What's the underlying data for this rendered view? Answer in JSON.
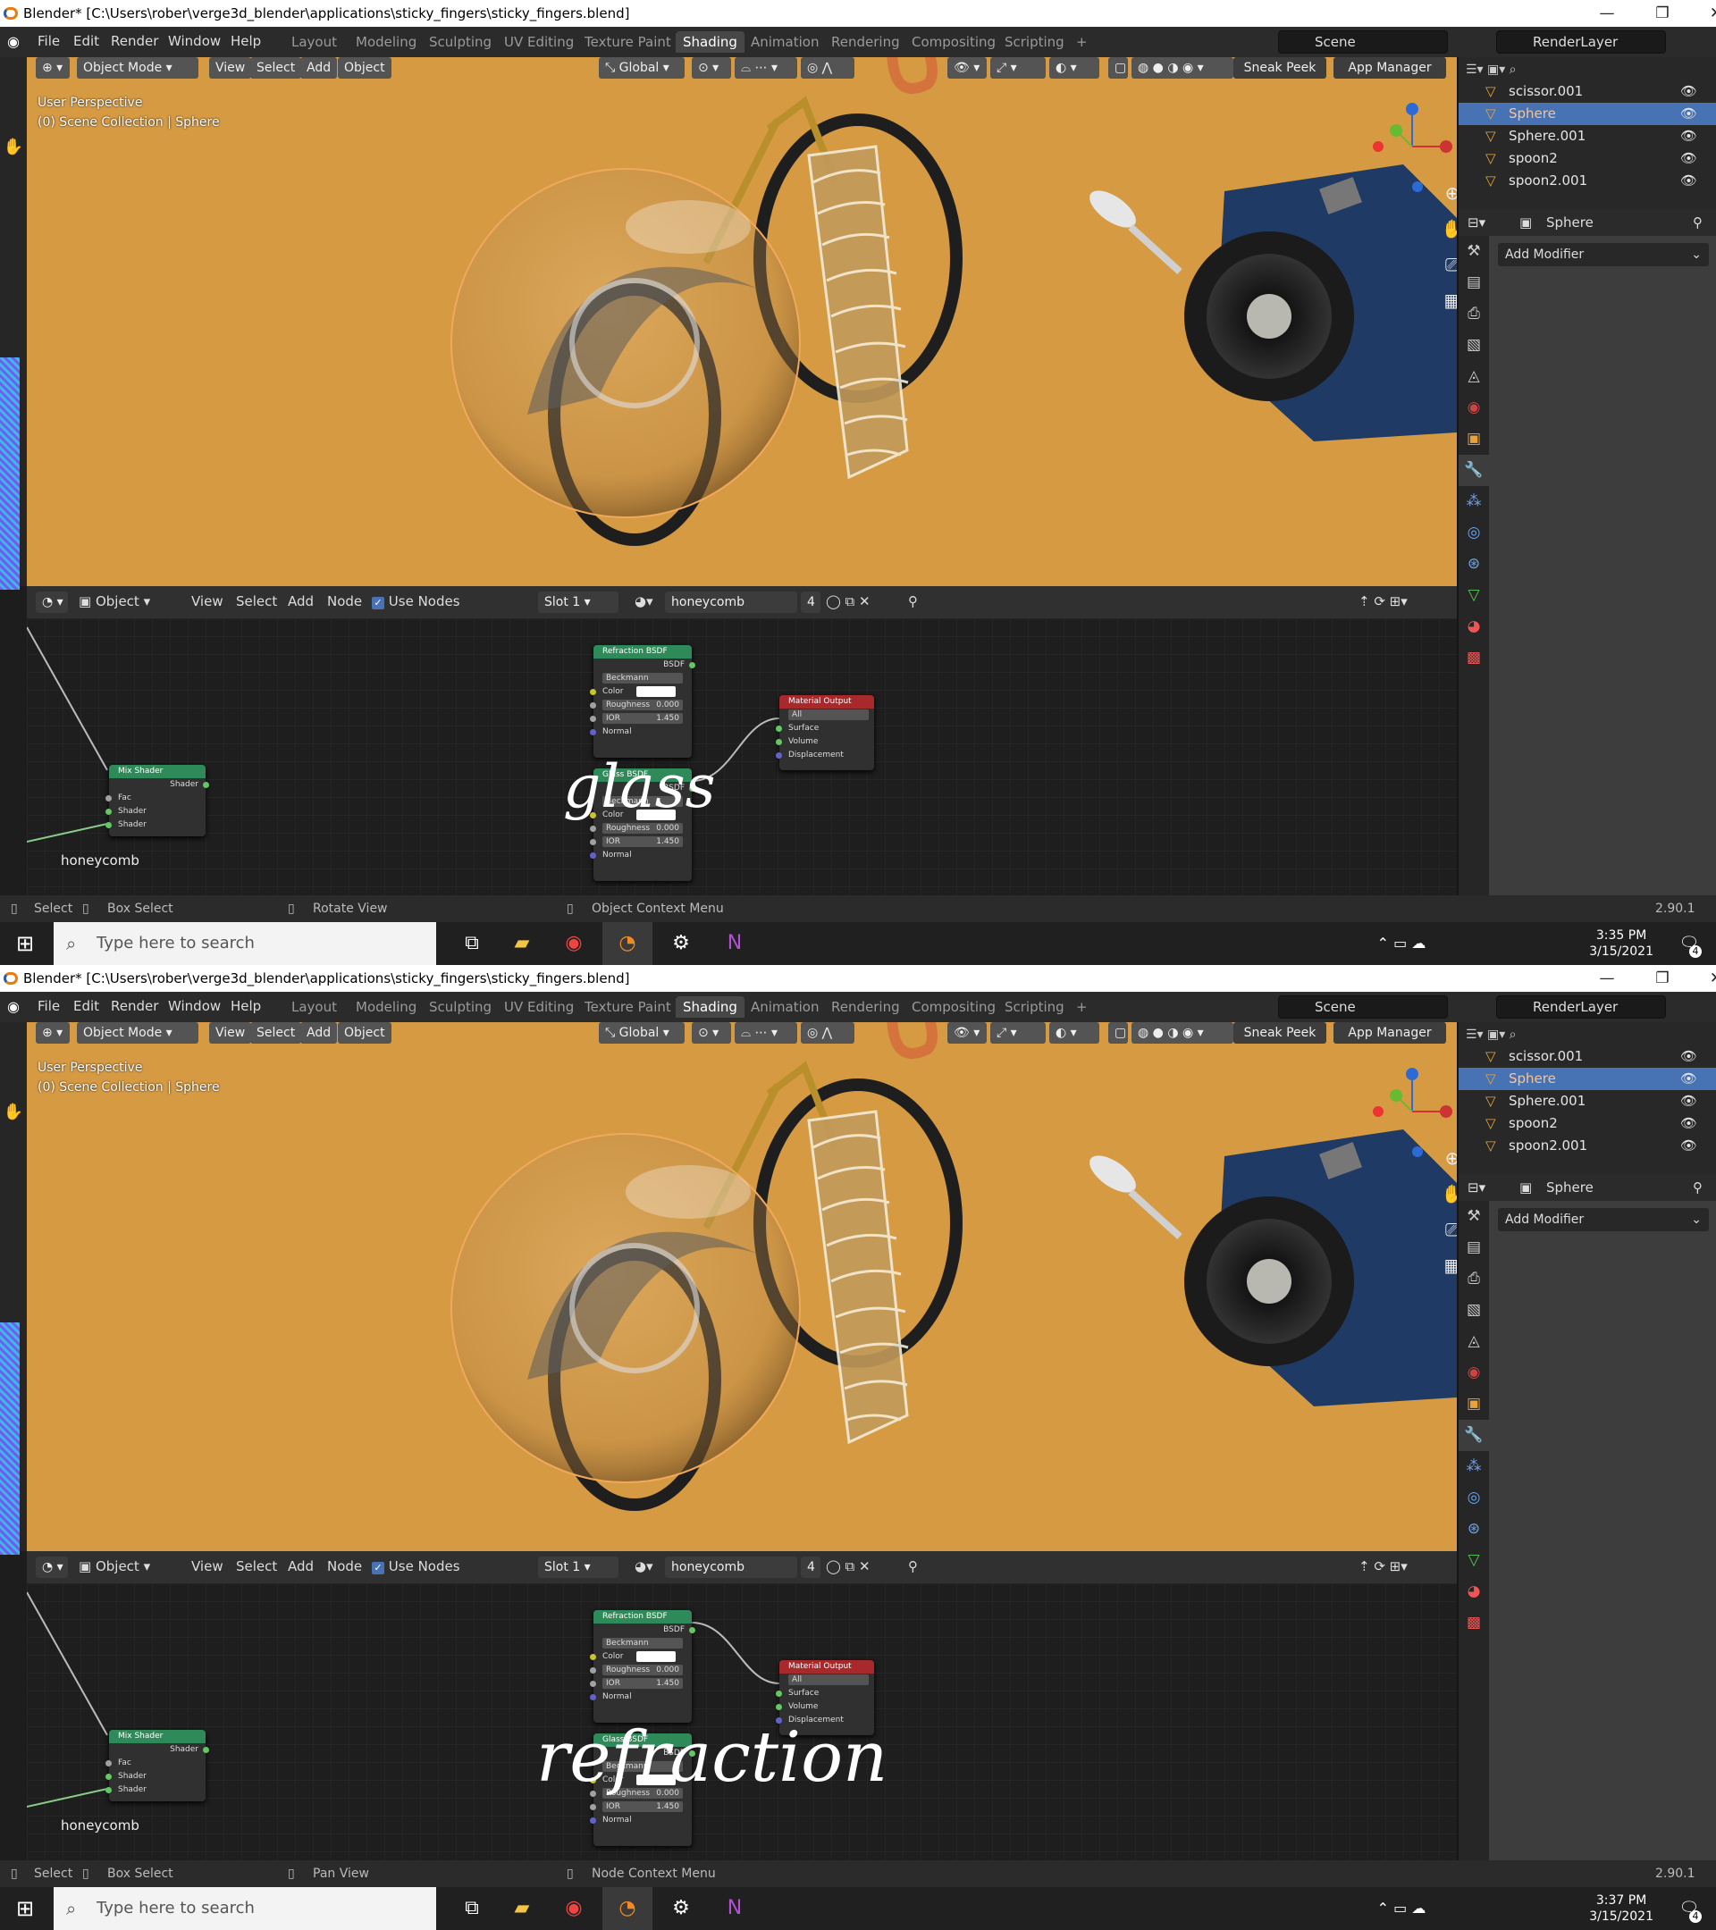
{
  "screens": [
    {
      "title": "Blender* [C:\\Users\\rober\\verge3d_blender\\applications\\sticky_fingers\\sticky_fingers.blend]",
      "menus": [
        "File",
        "Edit",
        "Render",
        "Window",
        "Help"
      ],
      "workspace_tabs": [
        "Layout",
        "Modeling",
        "Sculpting",
        "UV Editing",
        "Texture Paint",
        "Shading",
        "Animation",
        "Rendering",
        "Compositing",
        "Scripting"
      ],
      "active_tab": "Shading",
      "scene": "Scene",
      "render_layer": "RenderLayer",
      "viewport": {
        "mode": "Object Mode",
        "buttons": [
          "View",
          "Select",
          "Add",
          "Object"
        ],
        "transform": "Global",
        "sneak_peek": "Sneak Peek",
        "app_manager": "App Manager",
        "info_line1": "User Perspective",
        "info_line2": "(0) Scene Collection | Sphere"
      },
      "outliner": [
        {
          "name": "scissor.001",
          "selected": false
        },
        {
          "name": "Sphere",
          "selected": true
        },
        {
          "name": "Sphere.001",
          "selected": false
        },
        {
          "name": "spoon2",
          "selected": false
        },
        {
          "name": "spoon2.001",
          "selected": false
        }
      ],
      "properties": {
        "object": "Sphere",
        "add_modifier": "Add Modifier"
      },
      "node_header": {
        "mode": "Object",
        "menus": [
          "View",
          "Select",
          "Add",
          "Node"
        ],
        "use_nodes": "Use Nodes",
        "slot": "Slot 1",
        "material": "honeycomb",
        "users": "4"
      },
      "nodes": {
        "refraction": {
          "title": "Refraction BSDF",
          "out": "BSDF",
          "dist": "Beckmann",
          "color": "Color",
          "rough_label": "Roughness",
          "rough": "0.000",
          "ior_label": "IOR",
          "ior": "1.450",
          "normal": "Normal"
        },
        "glass": {
          "title": "Glass BSDF",
          "out": "BSDF",
          "dist": "Beckmann",
          "color": "Color",
          "rough_label": "Roughness",
          "rough": "0.000",
          "ior_label": "IOR",
          "ior": "1.450",
          "normal": "Normal"
        },
        "output": {
          "title": "Material Output",
          "target": "All",
          "surface": "Surface",
          "volume": "Volume",
          "displacement": "Displacement"
        },
        "mix": {
          "title": "Mix Shader",
          "out": "Shader",
          "fac": "Fac",
          "shader1": "Shader",
          "shader2": "Shader"
        },
        "frame_label": "honeycomb"
      },
      "handwriting": "glass",
      "status": {
        "select": "Select",
        "box": "Box Select",
        "middle": "Rotate View",
        "context": "Object Context Menu",
        "version": "2.90.1"
      },
      "taskbar": {
        "search": "Type here to search",
        "time": "3:35 PM",
        "date": "3/15/2021",
        "notif": "4"
      }
    },
    {
      "title": "Blender* [C:\\Users\\rober\\verge3d_blender\\applications\\sticky_fingers\\sticky_fingers.blend]",
      "menus": [
        "File",
        "Edit",
        "Render",
        "Window",
        "Help"
      ],
      "workspace_tabs": [
        "Layout",
        "Modeling",
        "Sculpting",
        "UV Editing",
        "Texture Paint",
        "Shading",
        "Animation",
        "Rendering",
        "Compositing",
        "Scripting"
      ],
      "active_tab": "Shading",
      "scene": "Scene",
      "render_layer": "RenderLayer",
      "viewport": {
        "mode": "Object Mode",
        "buttons": [
          "View",
          "Select",
          "Add",
          "Object"
        ],
        "transform": "Global",
        "sneak_peek": "Sneak Peek",
        "app_manager": "App Manager",
        "info_line1": "User Perspective",
        "info_line2": "(0) Scene Collection | Sphere"
      },
      "outliner": [
        {
          "name": "scissor.001",
          "selected": false
        },
        {
          "name": "Sphere",
          "selected": true
        },
        {
          "name": "Sphere.001",
          "selected": false
        },
        {
          "name": "spoon2",
          "selected": false
        },
        {
          "name": "spoon2.001",
          "selected": false
        }
      ],
      "properties": {
        "object": "Sphere",
        "add_modifier": "Add Modifier"
      },
      "node_header": {
        "mode": "Object",
        "menus": [
          "View",
          "Select",
          "Add",
          "Node"
        ],
        "use_nodes": "Use Nodes",
        "slot": "Slot 1",
        "material": "honeycomb",
        "users": "4"
      },
      "nodes": {
        "refraction": {
          "title": "Refraction BSDF",
          "out": "BSDF",
          "dist": "Beckmann",
          "color": "Color",
          "rough_label": "Roughness",
          "rough": "0.000",
          "ior_label": "IOR",
          "ior": "1.450",
          "normal": "Normal"
        },
        "glass": {
          "title": "Glass BSDF",
          "out": "BSDF",
          "dist": "Beckmann",
          "color": "Color",
          "rough_label": "Roughness",
          "rough": "0.000",
          "ior_label": "IOR",
          "ior": "1.450",
          "normal": "Normal"
        },
        "output": {
          "title": "Material Output",
          "target": "All",
          "surface": "Surface",
          "volume": "Volume",
          "displacement": "Displacement"
        },
        "mix": {
          "title": "Mix Shader",
          "out": "Shader",
          "fac": "Fac",
          "shader1": "Shader",
          "shader2": "Shader"
        },
        "frame_label": "honeycomb"
      },
      "handwriting": "refraction",
      "status": {
        "select": "Select",
        "box": "Box Select",
        "middle": "Pan View",
        "context": "Node Context Menu",
        "version": "2.90.1"
      },
      "taskbar": {
        "search": "Type here to search",
        "time": "3:37 PM",
        "date": "3/15/2021",
        "notif": "4"
      }
    }
  ],
  "colors": {
    "viewport_bg": "#d69a43",
    "selected_row": "#4772b3",
    "refraction_header": "#2f8a5a",
    "output_header": "#a8292c",
    "shader_socket": "#63c763",
    "color_socket": "#c7c729",
    "vector_socket": "#6363c7",
    "float_socket": "#a1a1a1"
  },
  "icons": [
    "blender-logo-icon",
    "eye-icon",
    "mesh-icon",
    "wrench-icon",
    "search-icon",
    "windows-start-icon",
    "chrome-icon",
    "file-explorer-icon",
    "settings-icon",
    "onenote-icon"
  ]
}
